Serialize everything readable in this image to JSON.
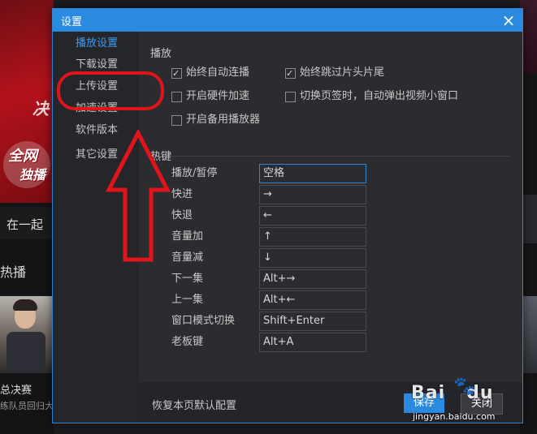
{
  "background": {
    "promo_line1": "全网",
    "promo_line2": "独播",
    "banner_glyph": "决",
    "label_together": "在一起",
    "label_broadcast": "热播",
    "label_final": "总决赛",
    "label_sub": "练队员回归大"
  },
  "dialog": {
    "title": "设置",
    "close_icon": "×",
    "accent_color": "#2a8ae0"
  },
  "sidebar": {
    "items": [
      {
        "label": "播放设置",
        "active": true
      },
      {
        "label": "下载设置",
        "active": false
      },
      {
        "label": "上传设置",
        "active": false
      },
      {
        "label": "加速设置",
        "active": false
      },
      {
        "label": "软件版本",
        "active": false
      },
      {
        "label": "其它设置",
        "active": false
      }
    ]
  },
  "playback": {
    "section_title": "播放",
    "options": [
      {
        "label": "始终自动连播",
        "checked": true
      },
      {
        "label": "始终跳过片头片尾",
        "checked": true
      },
      {
        "label": "开启硬件加速",
        "checked": false
      },
      {
        "label": "切换页签时，自动弹出视频小窗口",
        "checked": false
      },
      {
        "label": "开启备用播放器",
        "checked": false
      }
    ]
  },
  "hotkeys": {
    "section_title": "热键",
    "rows": [
      {
        "label": "播放/暂停",
        "value": "空格"
      },
      {
        "label": "快进",
        "value": "→"
      },
      {
        "label": "快退",
        "value": "←"
      },
      {
        "label": "音量加",
        "value": "↑"
      },
      {
        "label": "音量减",
        "value": "↓"
      },
      {
        "label": "下一集",
        "value": "Alt+→"
      },
      {
        "label": "上一集",
        "value": "Alt+←"
      },
      {
        "label": "窗口模式切换",
        "value": "Shift+Enter"
      },
      {
        "label": "老板键",
        "value": "Alt+A"
      }
    ]
  },
  "footer": {
    "restore_label": "恢复本页默认配置",
    "save_label": "保存",
    "close_label": "关闭"
  },
  "annotation": {
    "color": "#e0141b"
  },
  "watermark": {
    "logo": "Bai",
    "logo_tail": "du",
    "paw_icon": "🐾",
    "url": "jingyan.baidu.com"
  }
}
